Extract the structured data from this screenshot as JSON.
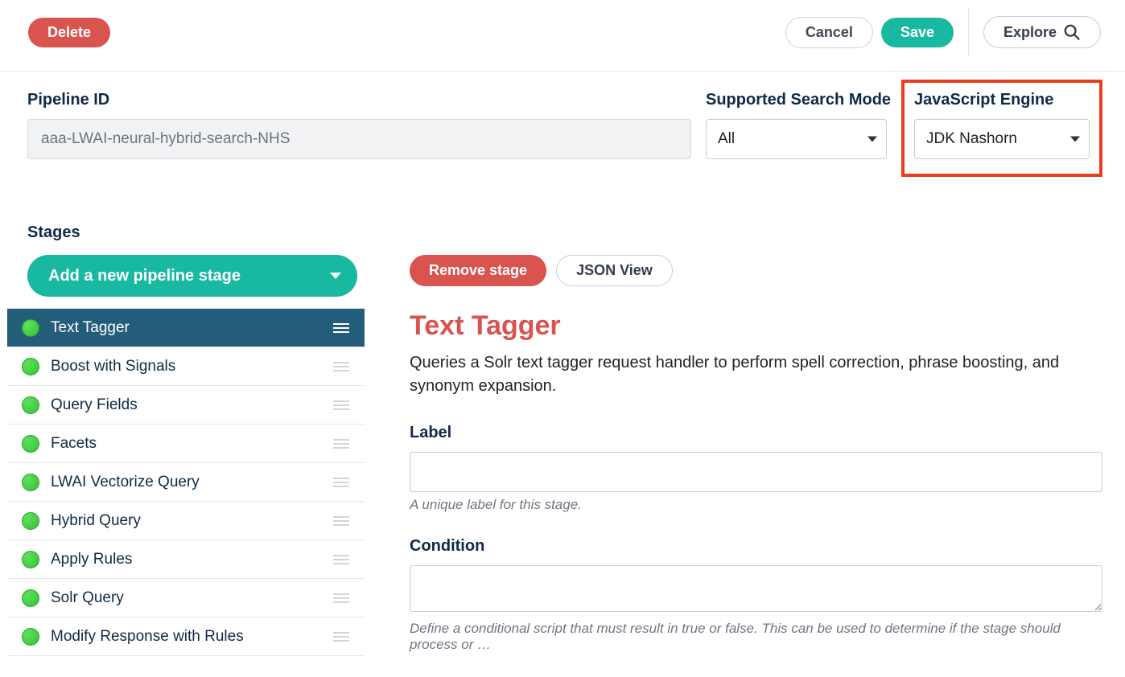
{
  "toolbar": {
    "delete": "Delete",
    "cancel": "Cancel",
    "save": "Save",
    "explore": "Explore"
  },
  "pipeline": {
    "id_label": "Pipeline ID",
    "id_value": "aaa-LWAI-neural-hybrid-search-NHS",
    "search_mode_label": "Supported Search Mode",
    "search_mode_value": "All",
    "js_engine_label": "JavaScript Engine",
    "js_engine_value": "JDK Nashorn"
  },
  "stages_label": "Stages",
  "add_stage": "Add a new pipeline stage",
  "stages": [
    {
      "name": "Text Tagger",
      "active": true
    },
    {
      "name": "Boost with Signals",
      "active": false
    },
    {
      "name": "Query Fields",
      "active": false
    },
    {
      "name": "Facets",
      "active": false
    },
    {
      "name": "LWAI Vectorize Query",
      "active": false
    },
    {
      "name": "Hybrid Query",
      "active": false
    },
    {
      "name": "Apply Rules",
      "active": false
    },
    {
      "name": "Solr Query",
      "active": false
    },
    {
      "name": "Modify Response with Rules",
      "active": false
    }
  ],
  "detail": {
    "remove": "Remove stage",
    "json_view": "JSON View",
    "title": "Text Tagger",
    "description": "Queries a Solr text tagger request handler to perform spell correction, phrase boosting, and synonym expansion.",
    "label_label": "Label",
    "label_value": "",
    "label_hint": "A unique label for this stage.",
    "condition_label": "Condition",
    "condition_value": "",
    "condition_hint": "Define a conditional script that must result in true or false. This can be used to determine if the stage should process or …"
  }
}
